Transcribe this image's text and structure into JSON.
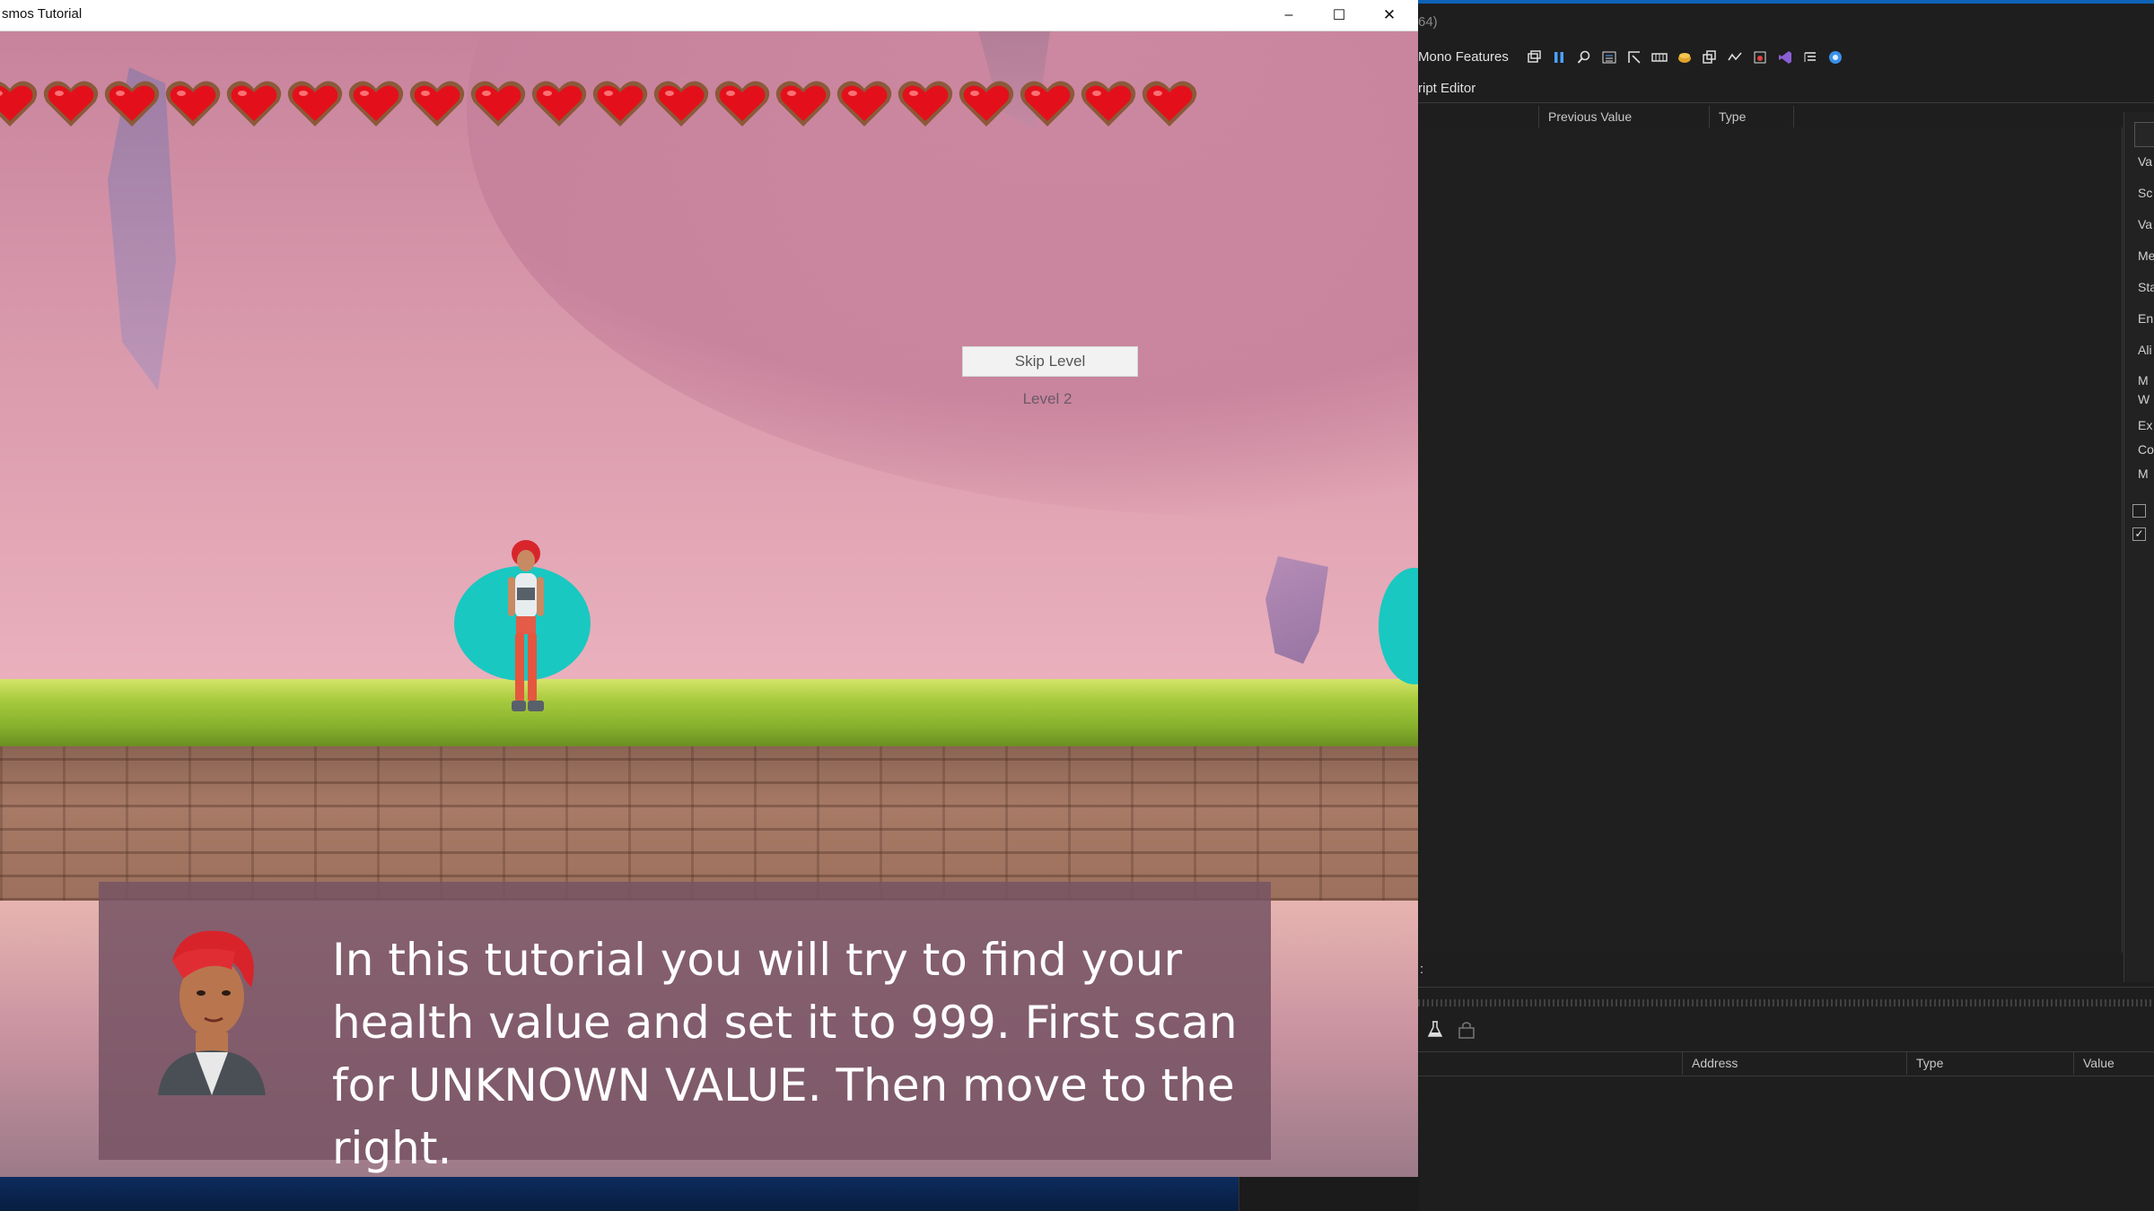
{
  "cheat_engine": {
    "title_fragment": "64)",
    "menu_item": "Mono Features",
    "menu_item_2": "ript Editor",
    "found_columns": [
      "Previous Value",
      "Type"
    ],
    "side_labels": [
      "Va",
      "Sc",
      "Va",
      "Me",
      "Sta",
      "En",
      "Ali",
      "M",
      "W",
      "Ex",
      "Co",
      "M"
    ],
    "checkbox_2_checked": "✓",
    "colon_label": ":",
    "address_columns": [
      "Address",
      "Type",
      "Value"
    ],
    "toolbar_icons": [
      "window-icon",
      "pause-icon",
      "search-icon",
      "list-icon",
      "pointer-icon",
      "memory-icon",
      "palette-icon",
      "copy-icon",
      "compare-icon",
      "debug-icon",
      "visual-studio-icon",
      "list-detail-icon",
      "settings-circle-icon"
    ]
  },
  "game_window": {
    "title": "smos Tutorial",
    "controls": {
      "minimize": "–",
      "maximize": "☐",
      "close": "✕"
    },
    "hearts_count": 20,
    "skip_button": "Skip Level",
    "level_label": "Level 2",
    "dialog_text": "In this tutorial you will try to find your health value and set it to 999. First scan for UNKNOWN VALUE. Then move to the right."
  },
  "colors": {
    "accent": "#0e63b6",
    "shield": "#19c8c1",
    "heart": "#e3101b"
  }
}
